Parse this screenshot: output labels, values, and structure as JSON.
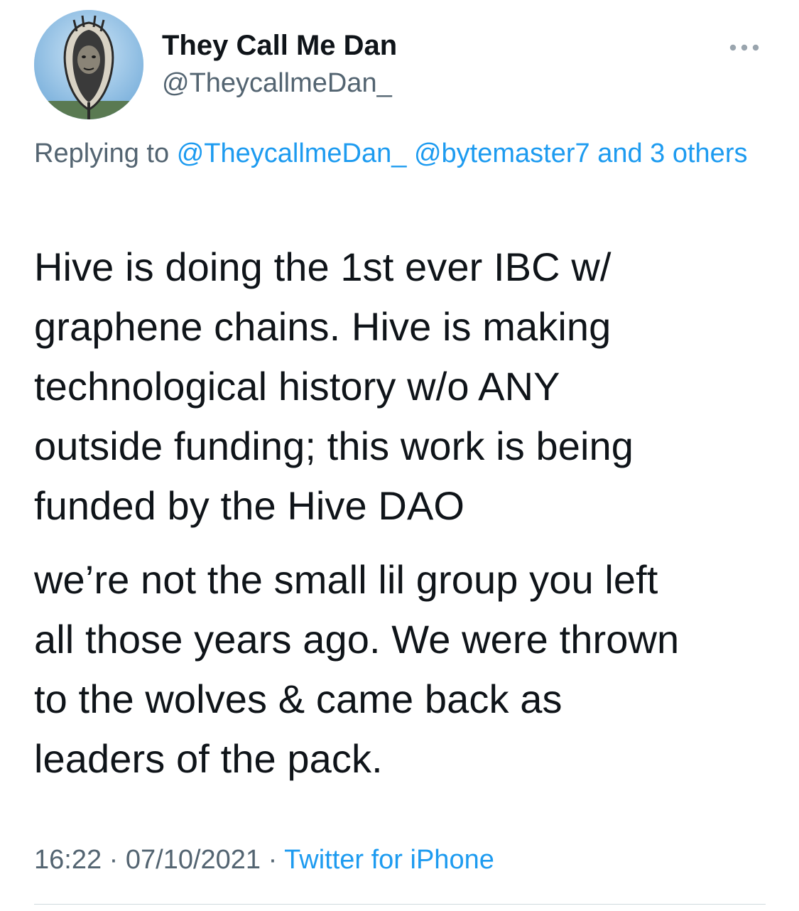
{
  "author": {
    "display_name": "They Call Me Dan",
    "handle": "@TheycallmeDan_"
  },
  "icons": {
    "more": "more-horizontal-icon",
    "avatar": "profile-avatar-image"
  },
  "reply": {
    "prefix": "Replying to",
    "mention_1": "@TheycallmeDan_",
    "mention_2": "@bytemaster7",
    "others": "and 3 others"
  },
  "tweet": {
    "paragraph_1_lines": [
      "Hive is doing the 1st ever IBC w/",
      "graphene chains. Hive is making",
      "technological history w/o ANY",
      "outside funding; this work is being",
      "funded by the Hive DAO"
    ],
    "paragraph_2_lines": [
      "we’re not the small lil group you left",
      "all those years ago. We were thrown",
      "to the wolves & came back as",
      "leaders of the pack."
    ]
  },
  "meta": {
    "time": "16:22",
    "separator": "·",
    "date": "07/10/2021",
    "source": "Twitter for iPhone"
  },
  "colors": {
    "text": "#0f1419",
    "secondary": "#536471",
    "link": "#1d9bf0",
    "divider": "#cfd9de"
  }
}
